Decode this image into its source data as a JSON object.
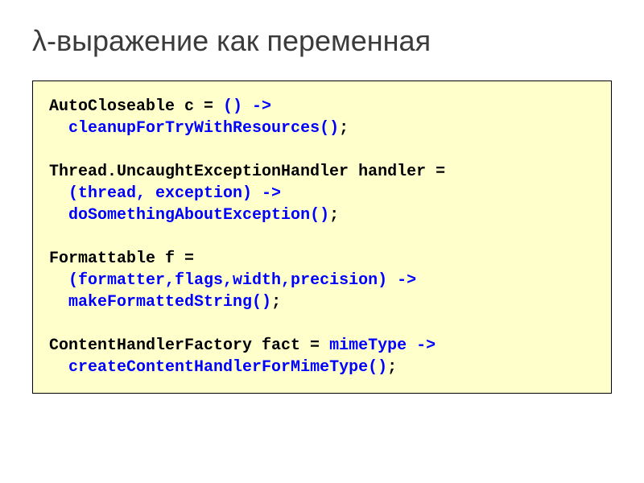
{
  "title": "λ-выражение как переменная",
  "code": {
    "l1a": "AutoCloseable c = ",
    "l1b": "() ->",
    "l2a": "  ",
    "l2b": "cleanupForTryWithResources()",
    "l2c": ";",
    "l3": "",
    "l4": "Thread.UncaughtExceptionHandler handler =",
    "l5a": "  ",
    "l5b": "(thread, exception) ->",
    "l6a": "  ",
    "l6b": "doSomethingAboutException()",
    "l6c": ";",
    "l7": "",
    "l8": "Formattable f =",
    "l9a": "  ",
    "l9b": "(formatter,flags,width,precision) ->",
    "l10a": "  ",
    "l10b": "makeFormattedString()",
    "l10c": ";",
    "l11": "",
    "l12a": "ContentHandlerFactory fact = ",
    "l12b": "mimeType ->",
    "l13a": "  ",
    "l13b": "createContentHandlerForMimeType()",
    "l13c": ";"
  }
}
